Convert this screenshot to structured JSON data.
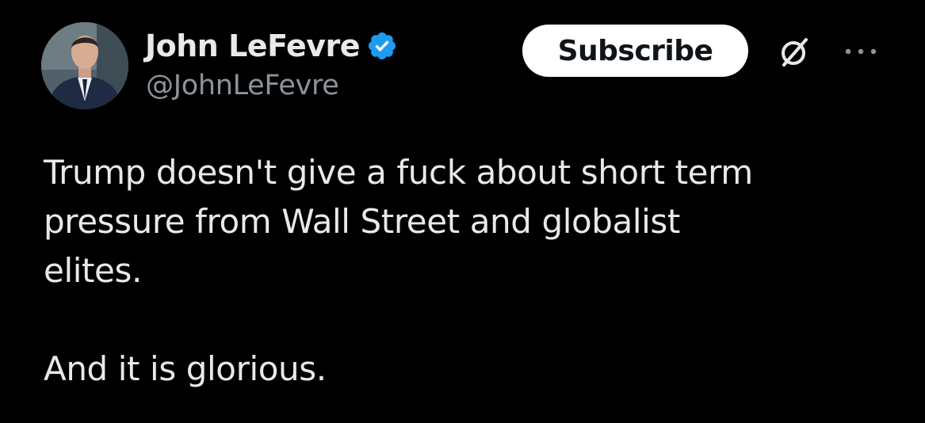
{
  "author": {
    "display_name": "John LeFevre",
    "handle": "@JohnLeFevre",
    "verified_icon": "verified-badge-icon",
    "verified_color": "#1d9bf0"
  },
  "actions": {
    "subscribe_label": "Subscribe",
    "grok_icon": "grok-slash-icon",
    "more_icon": "more-dots-icon"
  },
  "tweet": {
    "lines": [
      "Trump doesn't give a fuck about short term",
      "pressure from Wall Street and globalist",
      "elites."
    ],
    "closing": "And it is glorious."
  },
  "colors": {
    "background": "#000000",
    "text_primary": "#e7e9ea",
    "text_secondary": "#8b949b",
    "button_bg": "#ffffff",
    "button_text": "#0f1419"
  }
}
